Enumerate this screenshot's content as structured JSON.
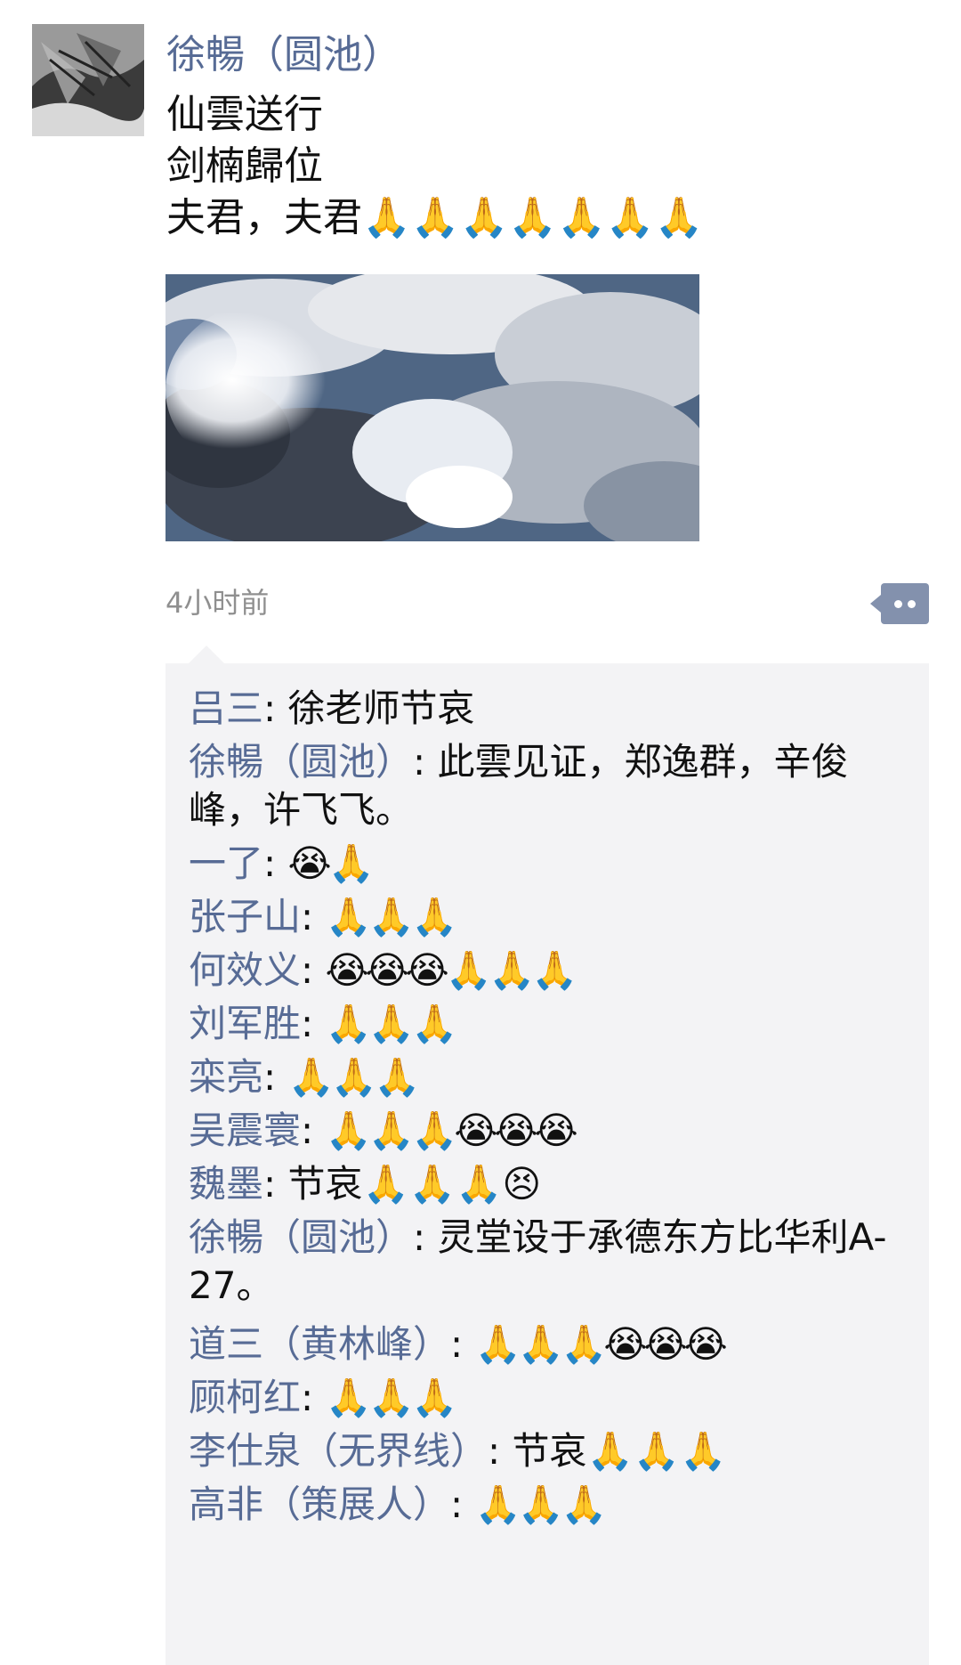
{
  "post": {
    "author": "徐暢（圆池）",
    "lines": [
      "仙雲送行",
      "剑楠歸位",
      "夫君，夫君🙏🙏🙏🙏🙏🙏🙏"
    ],
    "timestamp": "4小时前"
  },
  "comments": [
    {
      "name": "吕三",
      "text": "徐老师节哀"
    },
    {
      "name": "徐暢（圆池）",
      "text": "此雲见证，郑逸群，辛俊峰，许飞飞。"
    },
    {
      "name": "一了",
      "text": "😭🙏"
    },
    {
      "name": "张子山",
      "text": "🙏🙏🙏"
    },
    {
      "name": "何效义",
      "text": "😭😭😭🙏🙏🙏"
    },
    {
      "name": "刘军胜",
      "text": "🙏🙏🙏"
    },
    {
      "name": "栾亮",
      "text": "🙏🙏🙏"
    },
    {
      "name": "吴震寰",
      "text": "🙏🙏🙏😭😭😭"
    },
    {
      "name": "魏墨",
      "text": "节哀🙏🙏🙏😣"
    },
    {
      "name": "徐暢（圆池）",
      "text": "灵堂设于承德东方比华利A-27。"
    },
    {
      "name": "道三（黄林峰）",
      "text": "🙏🙏🙏😭😭😭"
    },
    {
      "name": "顾柯红",
      "text": "🙏🙏🙏"
    },
    {
      "name": "李仕泉（无界线）",
      "text": "节哀🙏🙏🙏"
    },
    {
      "name": "高非（策展人）",
      "text": "🙏🙏🙏"
    }
  ],
  "colors": {
    "name_link": "#576b95",
    "comment_bg": "#f3f3f5",
    "timestamp": "#8f8f8f",
    "more_button": "#8391ad"
  },
  "icons": {
    "more": "more-dots-icon",
    "avatar": "avatar-image",
    "photo": "cloud-sky-photo"
  }
}
